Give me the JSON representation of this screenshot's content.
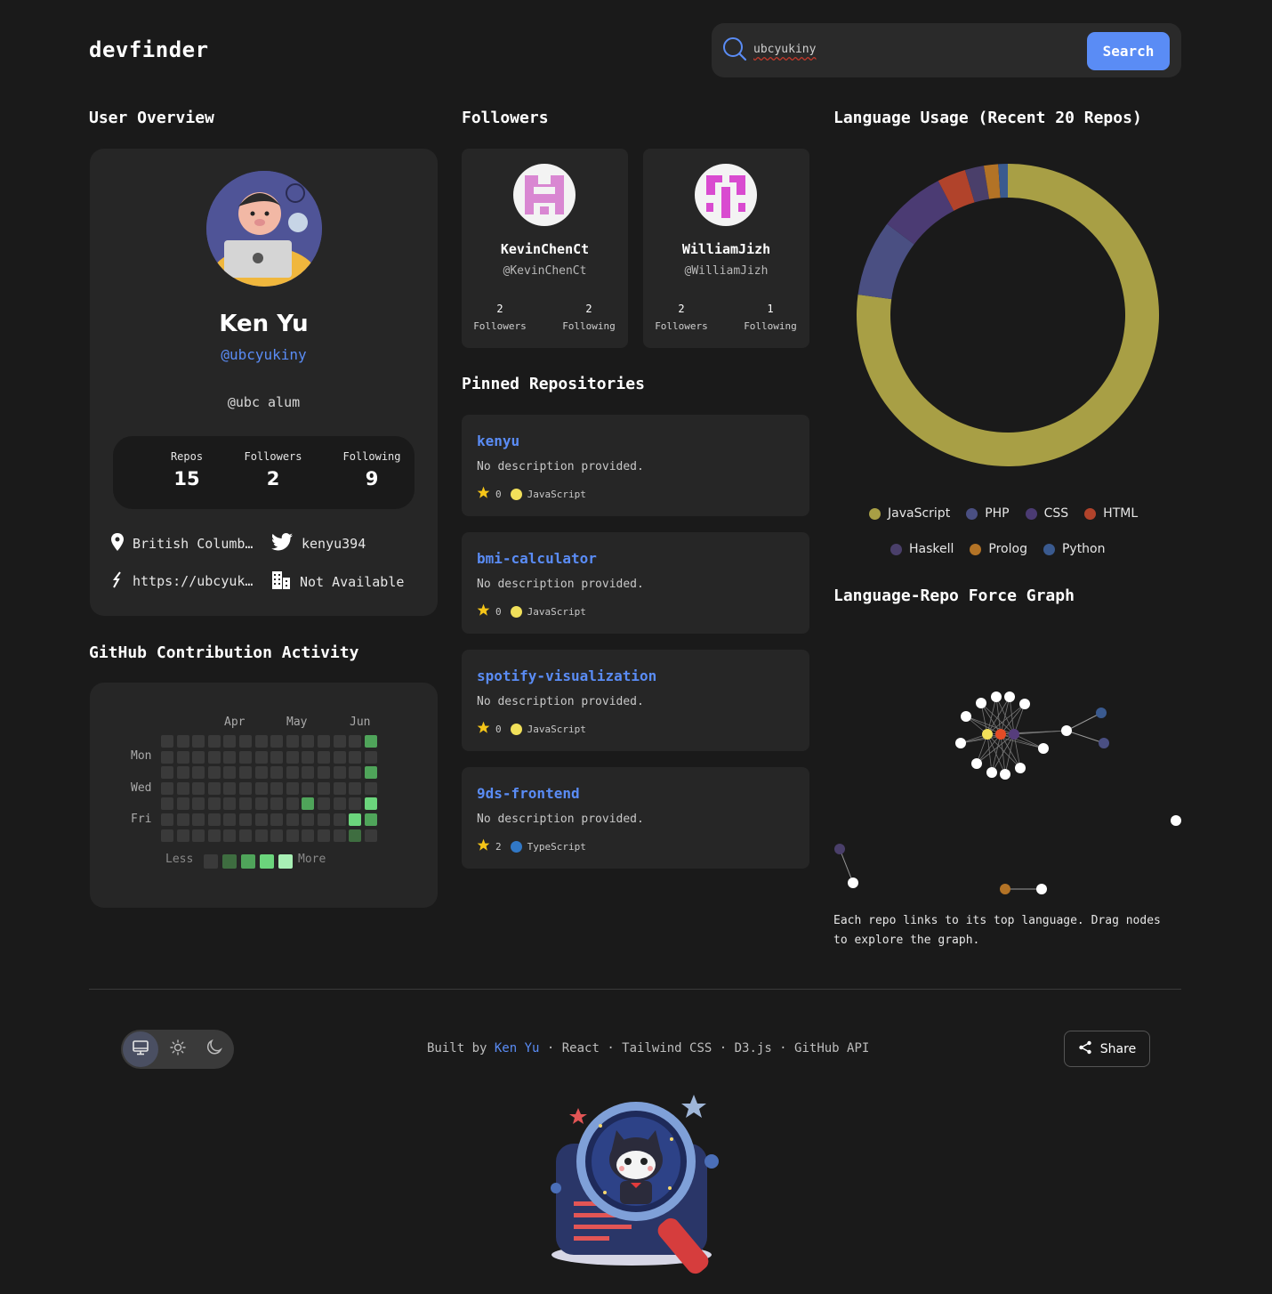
{
  "brand": "devfinder",
  "search": {
    "value": "ubcyukiny",
    "button": "Search"
  },
  "overview": {
    "title": "User Overview",
    "name": "Ken Yu",
    "handle": "@ubcyukiny",
    "bio": "@ubc alum",
    "stats": [
      {
        "label": "Repos",
        "value": "15"
      },
      {
        "label": "Followers",
        "value": "2"
      },
      {
        "label": "Following",
        "value": "9"
      }
    ],
    "location": "British Columb…",
    "twitter": "kenyu394",
    "website": "https://ubcyuk…",
    "company": "Not Available"
  },
  "followers": {
    "title": "Followers",
    "items": [
      {
        "name": "KevinChenCt",
        "handle": "@KevinChenCt",
        "followers": "2",
        "following": "2"
      },
      {
        "name": "WilliamJizh",
        "handle": "@WilliamJizh",
        "followers": "2",
        "following": "1"
      }
    ],
    "followers_label": "Followers",
    "following_label": "Following"
  },
  "pinned": {
    "title": "Pinned Repositories",
    "repos": [
      {
        "name": "kenyu",
        "desc": "No description provided.",
        "stars": "0",
        "lang": "JavaScript",
        "lang_color": "#f1e05a"
      },
      {
        "name": "bmi-calculator",
        "desc": "No description provided.",
        "stars": "0",
        "lang": "JavaScript",
        "lang_color": "#f1e05a"
      },
      {
        "name": "spotify-visualization",
        "desc": "No description provided.",
        "stars": "0",
        "lang": "JavaScript",
        "lang_color": "#f1e05a"
      },
      {
        "name": "9ds-frontend",
        "desc": "No description provided.",
        "stars": "2",
        "lang": "TypeScript",
        "lang_color": "#3178c6"
      }
    ]
  },
  "contrib": {
    "title": "GitHub Contribution Activity",
    "months": [
      "Apr",
      "May",
      "Jun"
    ],
    "days": [
      "Mon",
      "Wed",
      "Fri"
    ],
    "less": "Less",
    "more": "More",
    "active_cells": [
      {
        "col": 13,
        "row": 0,
        "level": 2
      },
      {
        "col": 13,
        "row": 2,
        "level": 2
      },
      {
        "col": 9,
        "row": 4,
        "level": 2
      },
      {
        "col": 13,
        "row": 4,
        "level": 3
      },
      {
        "col": 12,
        "row": 5,
        "level": 3
      },
      {
        "col": 13,
        "row": 5,
        "level": 2
      },
      {
        "col": 12,
        "row": 6,
        "level": 1
      }
    ]
  },
  "language": {
    "title": "Language Usage (Recent 20 Repos)"
  },
  "chart_data": {
    "type": "pie",
    "title": "Language Usage (Recent 20 Repos)",
    "categories": [
      "JavaScript",
      "PHP",
      "CSS",
      "HTML",
      "Haskell",
      "Prolog",
      "Python"
    ],
    "values": [
      76,
      8,
      7,
      3,
      2,
      1.5,
      1
    ],
    "colors": [
      "#a89f45",
      "#4a4f82",
      "#4b3b73",
      "#b1432b",
      "#4a3f6a",
      "#b37326",
      "#3a5a8f"
    ]
  },
  "force": {
    "title": "Language-Repo Force Graph",
    "note": "Each repo links to its top language. Drag nodes to explore the graph."
  },
  "footer": {
    "built_by": "Built by",
    "author": "Ken Yu",
    "tech": "· React · Tailwind CSS · D3.js · GitHub API",
    "share": "Share"
  }
}
